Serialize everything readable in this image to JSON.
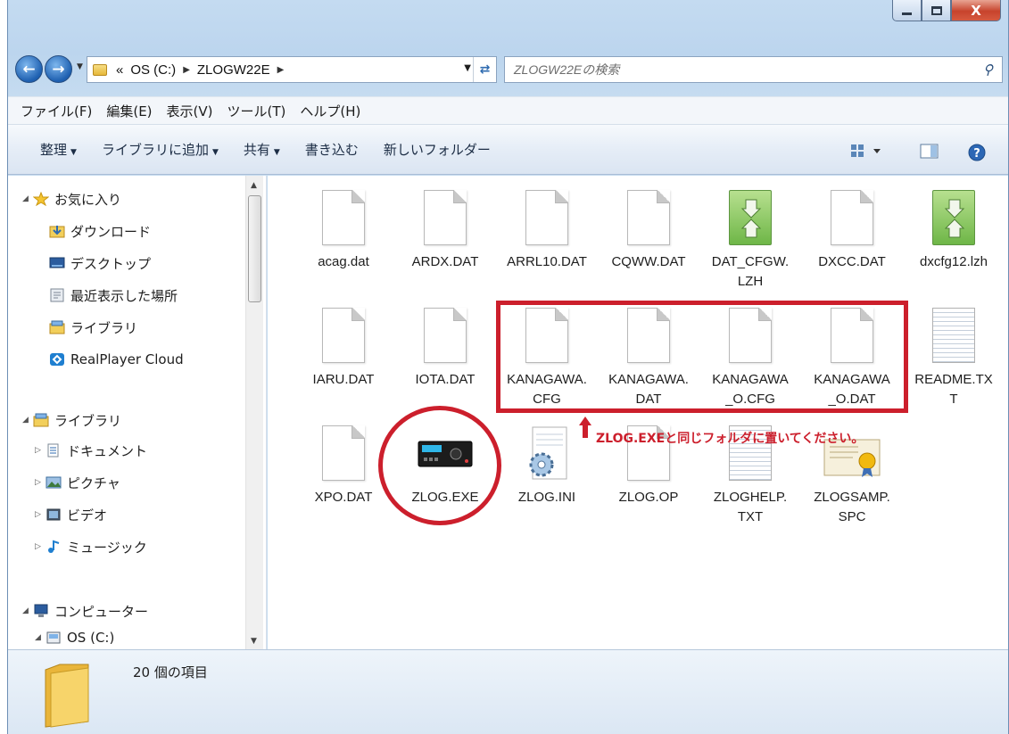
{
  "window": {
    "controls": {
      "minimize": "",
      "maximize": "",
      "close": "X"
    }
  },
  "address": {
    "chevron": "«",
    "crumbs": [
      "OS (C:)",
      "ZLOGW22E"
    ],
    "search_placeholder": "ZLOGW22Eの検索"
  },
  "menu": [
    "ファイル(F)",
    "編集(E)",
    "表示(V)",
    "ツール(T)",
    "ヘルプ(H)"
  ],
  "commands": [
    {
      "label": "整理",
      "dropdown": true
    },
    {
      "label": "ライブラリに追加",
      "dropdown": true
    },
    {
      "label": "共有",
      "dropdown": true
    },
    {
      "label": "書き込む",
      "dropdown": false
    },
    {
      "label": "新しいフォルダー",
      "dropdown": false
    }
  ],
  "nav": {
    "favorites": "お気に入り",
    "fav_items": [
      "ダウンロード",
      "デスクトップ",
      "最近表示した場所",
      "ライブラリ",
      "RealPlayer Cloud"
    ],
    "libraries": "ライブラリ",
    "lib_items": [
      "ドキュメント",
      "ピクチャ",
      "ビデオ",
      "ミュージック"
    ],
    "computer": "コンピューター",
    "computer_items": [
      "OS (C:)"
    ]
  },
  "files": [
    {
      "name": "acag.dat",
      "icon": "generic-file-icon"
    },
    {
      "name": "ARDX.DAT",
      "icon": "generic-file-icon"
    },
    {
      "name": "ARRL10.DAT",
      "icon": "generic-file-icon"
    },
    {
      "name": "CQWW.DAT",
      "icon": "generic-file-icon"
    },
    {
      "name": "DAT_CFGW.LZH",
      "icon": "archive-file-icon"
    },
    {
      "name": "DXCC.DAT",
      "icon": "generic-file-icon"
    },
    {
      "name": "dxcfg12.lzh",
      "icon": "archive-file-icon"
    },
    {
      "name": "IARU.DAT",
      "icon": "generic-file-icon"
    },
    {
      "name": "IOTA.DAT",
      "icon": "generic-file-icon"
    },
    {
      "name": "KANAGAWA.CFG",
      "icon": "generic-file-icon"
    },
    {
      "name": "KANAGAWA.DAT",
      "icon": "generic-file-icon"
    },
    {
      "name": "KANAGAWA_O.CFG",
      "icon": "generic-file-icon"
    },
    {
      "name": "KANAGAWA_O.DAT",
      "icon": "generic-file-icon"
    },
    {
      "name": "README.TXT",
      "icon": "text-file-icon"
    },
    {
      "name": "XPO.DAT",
      "icon": "generic-file-icon"
    },
    {
      "name": "ZLOG.EXE",
      "icon": "radio-app-icon"
    },
    {
      "name": "ZLOG.INI",
      "icon": "settings-file-icon"
    },
    {
      "name": "ZLOG.OP",
      "icon": "generic-file-icon"
    },
    {
      "name": "ZLOGHELP.TXT",
      "icon": "text-file-icon"
    },
    {
      "name": "ZLOGSAMP.SPC",
      "icon": "certificate-file-icon"
    }
  ],
  "annotation": "ZLOG.EXEと同じフォルダに置いてください。",
  "status": {
    "item_count": "20 個の項目"
  },
  "colors": {
    "annotation_red": "#cc1f2c",
    "chrome_blue": "#c4dbf1"
  }
}
